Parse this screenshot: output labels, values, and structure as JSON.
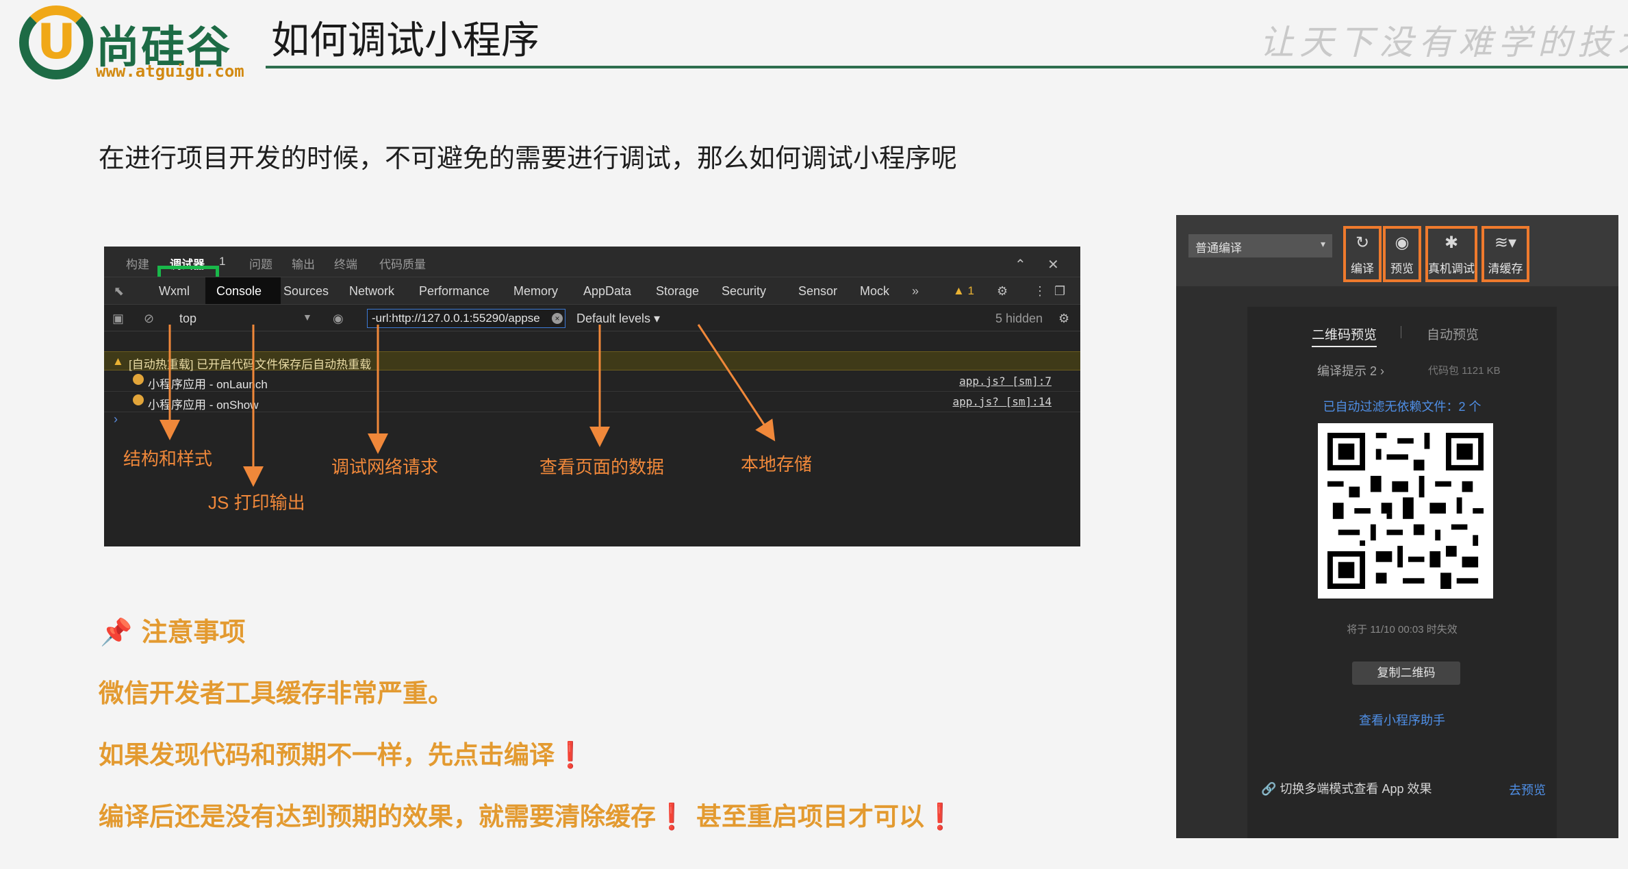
{
  "header": {
    "logo_text": "尚硅谷",
    "logo_url": "www.atguigu.com",
    "title": "如何调试小程序",
    "slogan": "让天下没有难学的技术"
  },
  "intro": "在进行项目开发的时候，不可避免的需要进行调试，那么如何调试小程序呢",
  "devtools": {
    "top_tabs": [
      "构建",
      "调试器",
      "问题",
      "输出",
      "终端",
      "代码质量"
    ],
    "active_top_badge": "1",
    "panel_tabs": [
      "Wxml",
      "Console",
      "Sources",
      "Network",
      "Performance",
      "Memory",
      "AppData",
      "Storage",
      "Security",
      "Sensor",
      "Mock"
    ],
    "more": "»",
    "warnings": "▲ 1",
    "filter": {
      "context": "top",
      "url_value": "-url:http://127.0.0.1:55290/appse",
      "levels": "Default levels ▾",
      "hidden": "5 hidden"
    },
    "warn_message": "[自动热重载] 已开启代码文件保存后自动热重载",
    "logs": [
      {
        "message": "小程序应用 - onLaunch",
        "source": "app.js? [sm]:7"
      },
      {
        "message": "小程序应用 - onShow",
        "source": "app.js? [sm]:14"
      }
    ],
    "annotations": {
      "wxml": "结构和样式",
      "console": "JS 打印输出",
      "network": "调试网络请求",
      "appdata": "查看页面的数据",
      "storage": "本地存储"
    },
    "colors": {
      "highlight": "#19b84a",
      "annotation": "#f0883a"
    }
  },
  "notes": {
    "title": "📌 注意事项",
    "items": [
      "微信开发者工具缓存非常严重。",
      "如果发现代码和预期不一样，先点击编译",
      "编译后还是没有达到预期的效果，就需要清除缓存",
      "甚至重启项目才可以"
    ],
    "bang": "❗"
  },
  "preview": {
    "compile_mode": "普通编译",
    "buttons": [
      {
        "label": "编译",
        "icon": "refresh-icon"
      },
      {
        "label": "预览",
        "icon": "eye-icon"
      },
      {
        "label": "真机调试",
        "icon": "bug-icon"
      },
      {
        "label": "清缓存",
        "icon": "layers-icon"
      }
    ],
    "tab_qr": "二维码预览",
    "tab_auto": "自动预览",
    "hint": "编译提示 2 ›",
    "size": "代码包 1121 KB",
    "filtered": "已自动过滤无依赖文件：2 个",
    "expire": "将于 11/10 00:03 时失效",
    "copy_button": "复制二维码",
    "helper_link": "查看小程序助手",
    "switch_text": "切换多端模式查看 App 效果",
    "go_preview": "去预览",
    "colors": {
      "button_border": "#ef7a2d",
      "link": "#4f8fe6"
    }
  }
}
